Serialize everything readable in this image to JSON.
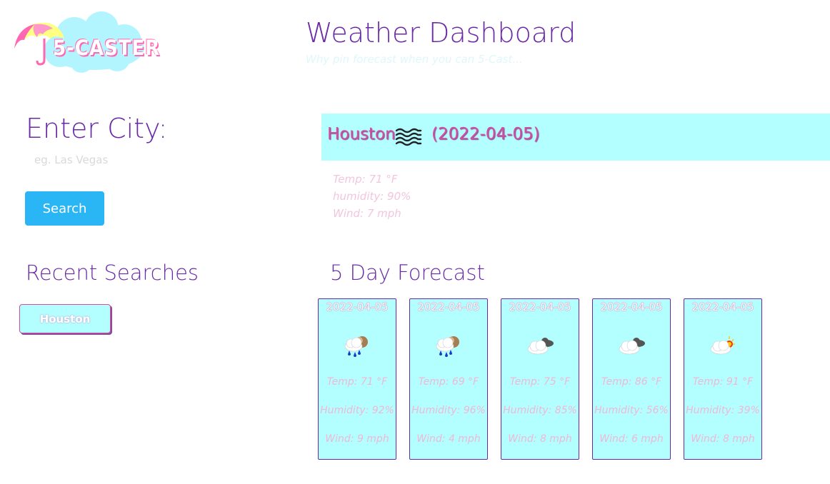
{
  "logo": {
    "text": "5-CASTER",
    "umbrella_colors": [
      "#ff66b3",
      "#ffff80"
    ],
    "cloud_color": "#b3f5ff"
  },
  "header": {
    "title": "Weather Dashboard",
    "subtitle": "Why pin forecast when you can 5-Cast..."
  },
  "search": {
    "label": "Enter City:",
    "placeholder": "eg. Las Vegas",
    "value": "",
    "button_label": "Search"
  },
  "recent": {
    "title": "Recent Searches",
    "items": [
      {
        "label": "Houston"
      }
    ]
  },
  "current": {
    "city": "Houston",
    "icon": "mist-icon",
    "date": "(2022-04-05)",
    "temp": "Temp: 71 °F",
    "humidity": "humidity: 90%",
    "wind": "Wind: 7 mph"
  },
  "forecast": {
    "title": "5 Day Forecast",
    "days": [
      {
        "date": "2022-04-05",
        "icon": "rain-icon",
        "temp": "Temp: 71 °F",
        "humidity": "Humidity: 92%",
        "wind": "Wind: 9 mph"
      },
      {
        "date": "2022-04-05",
        "icon": "rain-icon",
        "temp": "Temp: 69 °F",
        "humidity": "Humidity: 96%",
        "wind": "Wind: 4 mph"
      },
      {
        "date": "2022-04-05",
        "icon": "broken-clouds-icon",
        "temp": "Temp: 75 °F",
        "humidity": "Humidity: 85%",
        "wind": "Wind: 8 mph"
      },
      {
        "date": "2022-04-05",
        "icon": "broken-clouds-icon",
        "temp": "Temp: 86 °F",
        "humidity": "Humidity: 56%",
        "wind": "Wind: 6 mph"
      },
      {
        "date": "2022-04-05",
        "icon": "few-clouds-icon",
        "temp": "Temp: 91 °F",
        "humidity": "Humidity: 39%",
        "wind": "Wind: 8 mph"
      }
    ]
  },
  "colors": {
    "heading_purple": "#6a2aa8",
    "panel_cyan": "#b3ffff",
    "accent_pink": "#d34f9e",
    "button_blue": "#2ab5f5"
  }
}
